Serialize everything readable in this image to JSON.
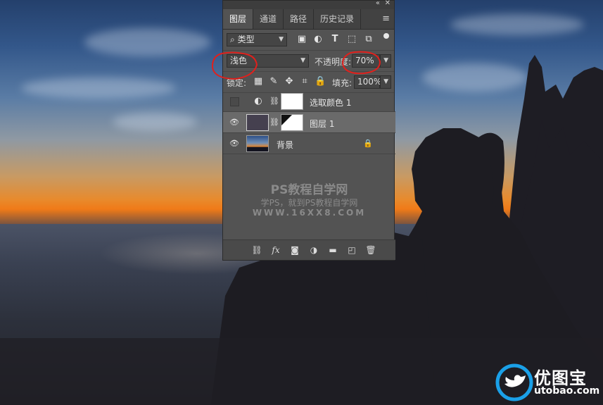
{
  "panel": {
    "tabs": [
      "图层",
      "通道",
      "路径",
      "历史记录"
    ],
    "active_tab": 0,
    "filter": {
      "search_label": "类型"
    },
    "blend_mode": "浅色",
    "opacity_label": "不透明度:",
    "opacity_value": "70%",
    "lock_label": "锁定:",
    "fill_label": "填充:",
    "fill_value": "100%",
    "layers": [
      {
        "name": "选取颜色 1",
        "visible": false,
        "selected": false
      },
      {
        "name": "图层 1",
        "visible": true,
        "selected": true
      },
      {
        "name": "背景",
        "visible": true,
        "selected": false,
        "locked": true
      }
    ],
    "watermark": {
      "title": "PS教程自学网",
      "subtitle": "学PS，就到PS教程自学网",
      "url": "WWW.16XX8.COM"
    }
  },
  "logo": {
    "name": "优图宝",
    "url": "utobao.com"
  },
  "colors": {
    "panel_bg": "#535353",
    "selected_layer": "#6a6a6a",
    "annotation": "#e0201c",
    "logo_blue": "#1aa0e8"
  }
}
